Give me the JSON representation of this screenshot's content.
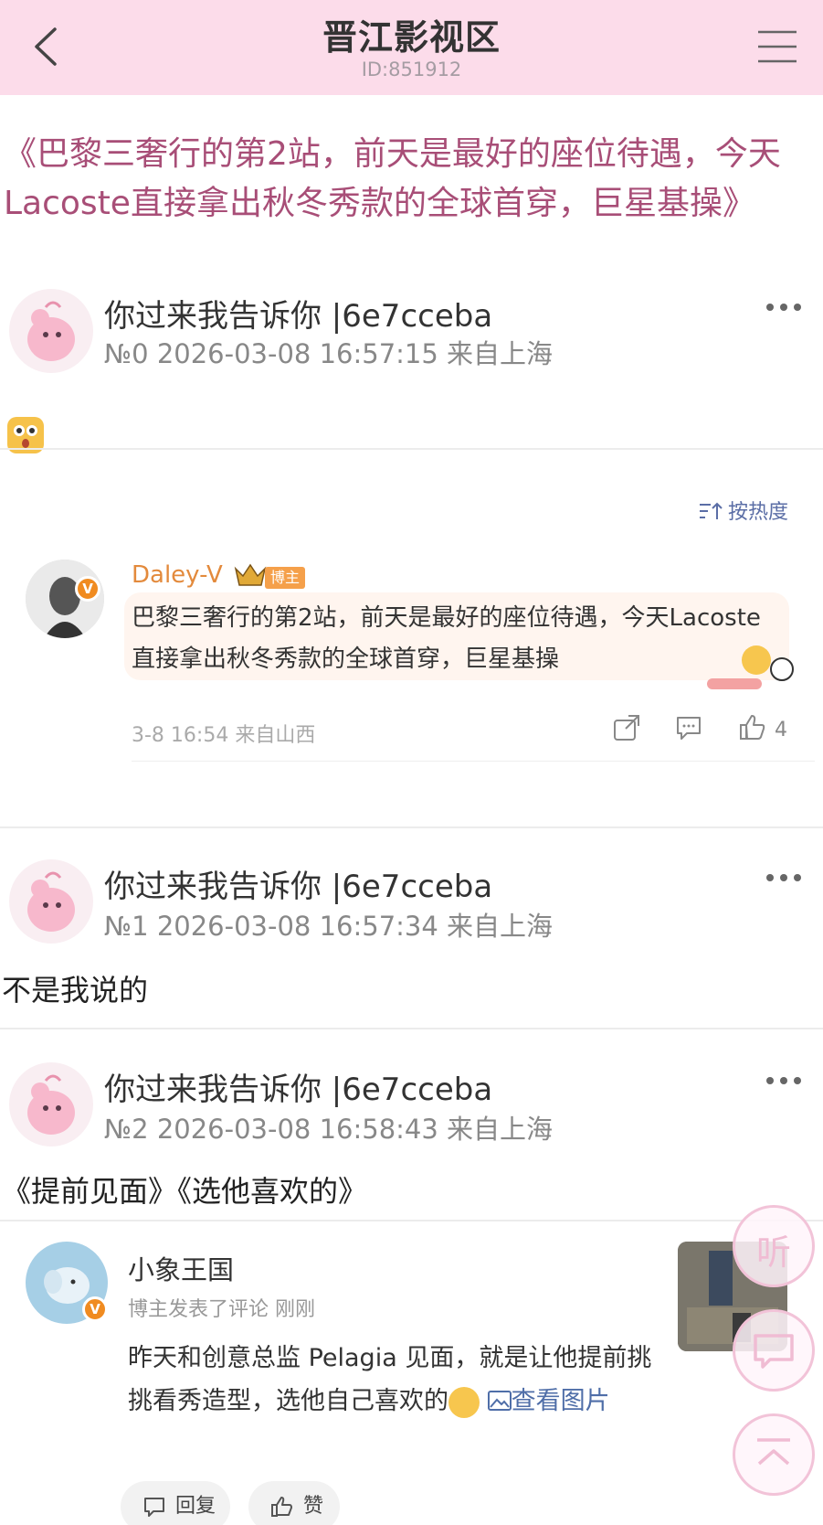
{
  "header": {
    "title": "晋江影视区",
    "forum_id": "ID:851912"
  },
  "thread": {
    "title": "《巴黎三奢行的第2站，前天是最好的座位待遇，今天Lacoste直接拿出秋冬秀款的全球首穿，巨星基操》"
  },
  "posts": [
    {
      "user": "你过来我告诉你 |6e7cceba",
      "meta": "№0 2026-03-08 16:57:15 来自上海",
      "content": "",
      "sort_label": "按热度",
      "embedded_reply": {
        "author": "Daley-V",
        "tag": "博主",
        "text": "巴黎三奢行的第2站，前天是最好的座位待遇，今天Lacoste直接拿出秋冬秀款的全球首穿，巨星基操",
        "meta": "3-8 16:54  来自山西",
        "like_count": "4"
      }
    },
    {
      "user": "你过来我告诉你 |6e7cceba",
      "meta": "№1 2026-03-08 16:57:34 来自上海",
      "content": "不是我说的"
    },
    {
      "user": "你过来我告诉你 |6e7cceba",
      "meta": "№2 2026-03-08 16:58:43 来自上海",
      "content": "《提前见面》《选他喜欢的》",
      "embedded_card": {
        "author": "小象王国",
        "sub": "博主发表了评论   刚刚",
        "text": "昨天和创意总监 Pelagia 见面，就是让他提前挑挑看秀造型，选他自己喜欢的",
        "link": "查看图片",
        "reply_label": "回复",
        "like_label": "赞"
      }
    }
  ],
  "float_buttons": {
    "listen": "听"
  },
  "colors": {
    "header_bg": "#fcdcea",
    "title_color": "#a84e77",
    "link": "#4f6ea8",
    "badge_orange": "#f08b20"
  }
}
